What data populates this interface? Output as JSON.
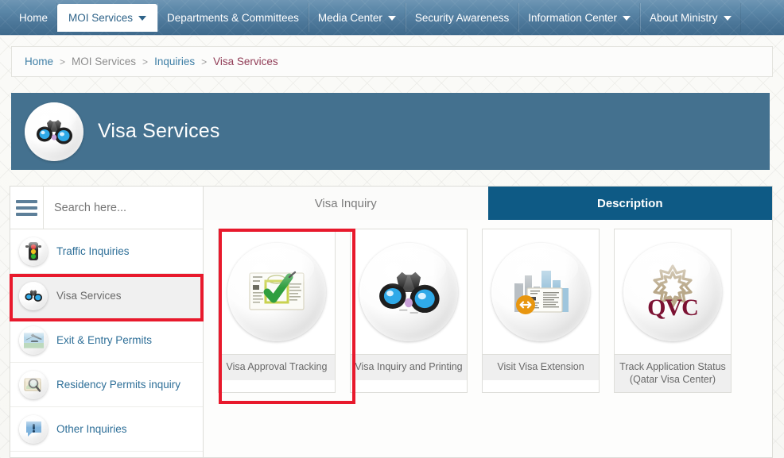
{
  "navbar": {
    "items": [
      {
        "label": "Home",
        "has_caret": false,
        "active": false
      },
      {
        "label": "MOI Services",
        "has_caret": true,
        "active": true
      },
      {
        "label": "Departments & Committees",
        "has_caret": false,
        "active": false
      },
      {
        "label": "Media Center",
        "has_caret": true,
        "active": false
      },
      {
        "label": "Security Awareness",
        "has_caret": false,
        "active": false
      },
      {
        "label": "Information Center",
        "has_caret": true,
        "active": false
      },
      {
        "label": "About Ministry",
        "has_caret": true,
        "active": false
      }
    ]
  },
  "breadcrumb": {
    "items": [
      {
        "label": "Home",
        "style": "link"
      },
      {
        "label": "MOI Services",
        "style": "muted"
      },
      {
        "label": "Inquiries",
        "style": "link"
      },
      {
        "label": "Visa Services",
        "style": "current"
      }
    ],
    "separator": ">"
  },
  "banner": {
    "title": "Visa Services",
    "icon": "binoculars-icon"
  },
  "sidebar": {
    "search": {
      "value": "",
      "placeholder": "Search here..."
    },
    "menu_icon": "hamburger-icon",
    "items": [
      {
        "label": "Traffic Inquiries",
        "icon": "traffic-light-icon",
        "active": false
      },
      {
        "label": "Visa Services",
        "icon": "binoculars-icon",
        "active": true
      },
      {
        "label": "Exit & Entry Permits",
        "icon": "airplane-icon",
        "active": false
      },
      {
        "label": "Residency Permits inquiry",
        "icon": "magnifier-document-icon",
        "active": false
      },
      {
        "label": "Other Inquiries",
        "icon": "exclamation-icon",
        "active": false
      }
    ]
  },
  "content": {
    "tabs": [
      {
        "label": "Visa Inquiry",
        "active": false
      },
      {
        "label": "Description",
        "active": true
      }
    ],
    "cards": [
      {
        "label": "Visa Approval Tracking",
        "icon": "document-checkmark-icon",
        "highlighted": true
      },
      {
        "label": "Visa Inquiry and Printing",
        "icon": "binoculars-icon",
        "highlighted": false
      },
      {
        "label": "Visit Visa Extension",
        "icon": "city-document-extend-icon",
        "highlighted": false
      },
      {
        "label": "Track Application Status (Qatar Visa Center)",
        "icon": "qvc-logo-icon",
        "highlighted": false
      }
    ]
  },
  "colors": {
    "nav_blue": "#4a7597",
    "banner_blue": "#44718f",
    "tab_active": "#0e5a85",
    "annotation_red": "#e8192c",
    "breadcrumb_current": "#913c56",
    "link_blue": "#2e6f98",
    "qvc_maroon": "#7c1233",
    "extension_orange": "#e8960f"
  }
}
